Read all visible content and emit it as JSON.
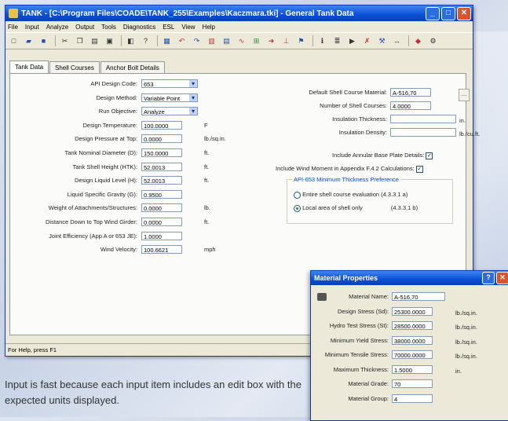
{
  "window": {
    "title": "TANK - [C:\\Program Files\\COADE\\TANK_255\\Examples\\Kaczmara.tki] - General Tank Data",
    "controls": [
      "_",
      "□",
      "✕"
    ]
  },
  "menu": [
    "File",
    "Input",
    "Analyze",
    "Output",
    "Tools",
    "Diagnostics",
    "ESL",
    "View",
    "Help"
  ],
  "tabs": [
    "Tank Data",
    "Shell Courses",
    "Anchor Bolt Details"
  ],
  "left_fields": [
    {
      "label": "API Design Code:",
      "value": "653",
      "unit": "",
      "type": "select"
    },
    {
      "label": "Design Method:",
      "value": "Variable Point",
      "unit": "",
      "type": "select"
    },
    {
      "label": "Run Objective:",
      "value": "Analyze",
      "unit": "",
      "type": "select"
    },
    {
      "label": "Design Temperature:",
      "value": "100.0000",
      "unit": "F",
      "type": "text"
    },
    {
      "label": "Design Pressure at Top:",
      "value": "0.0000",
      "unit": "lb./sq.in.",
      "type": "text"
    },
    {
      "label": "Tank Nominal Diameter (D):",
      "value": "150.0000",
      "unit": "ft.",
      "type": "text"
    },
    {
      "label": "Tank Shell Height (HTK):",
      "value": "52.0013",
      "unit": "ft.",
      "type": "text"
    },
    {
      "label": "Design Liquid Level (H):",
      "value": "52.0013",
      "unit": "ft.",
      "type": "text"
    },
    {
      "label": "Liquid Specific Gravity (G):",
      "value": "0.9500",
      "unit": "",
      "type": "text"
    },
    {
      "label": "Weight of Attachments/Structures:",
      "value": "0.0000",
      "unit": "lb.",
      "type": "text"
    },
    {
      "label": "Distance Down to Top Wind Girder:",
      "value": "0.0000",
      "unit": "ft.",
      "type": "text"
    },
    {
      "label": "Joint Efficiency (App A or 653 JE):",
      "value": "1.0000",
      "unit": "",
      "type": "text"
    },
    {
      "label": "Wind Velocity:",
      "value": "100.6621",
      "unit": "mph",
      "type": "text"
    }
  ],
  "right_fields": [
    {
      "label": "Default Shell Course Material:",
      "value": "A-516,70",
      "unit": ""
    },
    {
      "label": "Number of Shell Courses:",
      "value": "4.0000",
      "unit": ""
    },
    {
      "label": "Insulation Thickness:",
      "value": "",
      "unit": "in."
    },
    {
      "label": "Insulation Density:",
      "value": "",
      "unit": "lb./cu.ft."
    }
  ],
  "checkboxes": [
    {
      "label": "Include Annular Base Plate Details:",
      "checked": "✓"
    },
    {
      "label": "Include Wind Moment in Appendix F.4.2 Calculations:",
      "checked": "✓"
    }
  ],
  "group": {
    "title": "API-653 Minimum Thickness Preference",
    "options": [
      {
        "label": "Entire shell course evaluation (4.3.3.1 a)",
        "ref": "",
        "selected": false
      },
      {
        "label": "Local area of shell only",
        "ref": "(4.3.3.1 b)",
        "selected": true
      }
    ]
  },
  "status": "For Help, press F1",
  "caption": "Input is fast because each input item includes an edit box with the expected units displayed.",
  "dialog": {
    "title": "Material Properties",
    "fields": [
      {
        "label": "Material Name:",
        "value": "A-516,70",
        "unit": ""
      },
      {
        "label": "Design Stress (Sd):",
        "value": "25300.0000",
        "unit": "lb./sq.in."
      },
      {
        "label": "Hydro Test Stress (St):",
        "value": "28500.0000",
        "unit": "lb./sq.in."
      },
      {
        "label": "Minimum Yield Stress:",
        "value": "38000.0000",
        "unit": "lb./sq.in."
      },
      {
        "label": "Minimum Tensile Stress:",
        "value": "70000.0000",
        "unit": "lb./sq.in."
      },
      {
        "label": "Maximum Thickness:",
        "value": "1.5000",
        "unit": "in."
      },
      {
        "label": "Material Grade:",
        "value": "70",
        "unit": ""
      },
      {
        "label": "Material Group:",
        "value": "4",
        "unit": ""
      }
    ]
  }
}
